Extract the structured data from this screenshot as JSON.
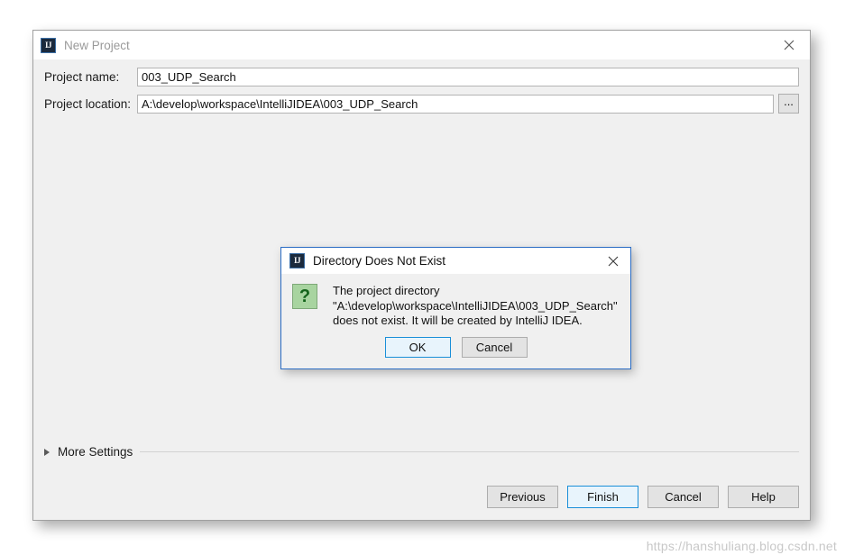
{
  "window": {
    "title": "New Project",
    "logo_text": "IJ",
    "logo_icon": "intellij-idea-logo",
    "close_icon": "close-icon"
  },
  "form": {
    "project_name": {
      "label": "Project name:",
      "value": "003_UDP_Search",
      "placeholder": ""
    },
    "project_location": {
      "label": "Project location:",
      "value": "A:\\develop\\workspace\\IntelliJIDEA\\003_UDP_Search",
      "placeholder": ""
    },
    "browse_button_label": "..."
  },
  "more_settings": {
    "label": "More Settings",
    "expander_icon": "chevron-right-icon",
    "expanded": false
  },
  "buttons": {
    "previous": "Previous",
    "finish": "Finish",
    "cancel": "Cancel",
    "help": "Help"
  },
  "dialog": {
    "title": "Directory Does Not Exist",
    "logo_text": "IJ",
    "logo_icon": "intellij-idea-logo",
    "close_icon": "close-icon",
    "icon": "question-icon",
    "icon_glyph": "?",
    "message": "The project directory\n\"A:\\develop\\workspace\\IntelliJIDEA\\003_UDP_Search\"\ndoes not exist. It will be created by IntelliJ IDEA.",
    "ok_label": "OK",
    "cancel_label": "Cancel"
  },
  "watermark": {
    "text": "https://hanshuliang.blog.csdn.net"
  },
  "colors": {
    "accent_blue": "#1a8fd8",
    "dialog_border": "#2a6cc4",
    "window_body": "#f0f0f0",
    "question_green": "#a8d4a0",
    "logo_navy": "#1b2a3d"
  }
}
